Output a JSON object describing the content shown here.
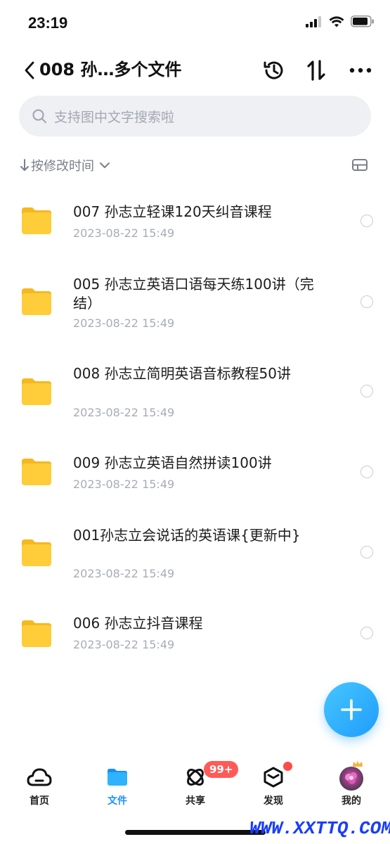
{
  "status_bar": {
    "time": "23:19"
  },
  "header": {
    "title": "008 孙…多个文件"
  },
  "search": {
    "placeholder": "支持图中文字搜索啦"
  },
  "sort": {
    "label": "按修改时间"
  },
  "files": [
    {
      "name": "007 孙志立轻课120天纠音课程",
      "date": "2023-08-22 15:49"
    },
    {
      "name": "005 孙志立英语口语每天练100讲（完结）",
      "date": "2023-08-22 15:49"
    },
    {
      "name": "008 孙志立简明英语音标教程50讲",
      "date": "2023-08-22 15:49"
    },
    {
      "name": "009 孙志立英语自然拼读100讲",
      "date": "2023-08-22 15:49"
    },
    {
      "name": "001孙志立会说话的英语课{更新中}",
      "date": "2023-08-22 15:49"
    },
    {
      "name": "006 孙志立抖音课程",
      "date": "2023-08-22 15:49"
    }
  ],
  "tabs": [
    {
      "label": "首页",
      "icon": "cloud-icon"
    },
    {
      "label": "文件",
      "icon": "folder-icon"
    },
    {
      "label": "共享",
      "icon": "share-orbit-icon"
    },
    {
      "label": "发现",
      "icon": "cube-icon"
    },
    {
      "label": "我的",
      "icon": "avatar"
    }
  ],
  "badges": {
    "share_count": "99+"
  },
  "watermark": "WWW.XXTTQ.COM",
  "colors": {
    "accent": "#1e90ff",
    "folder": "#ffcd3a",
    "badge": "#ff5a57"
  }
}
